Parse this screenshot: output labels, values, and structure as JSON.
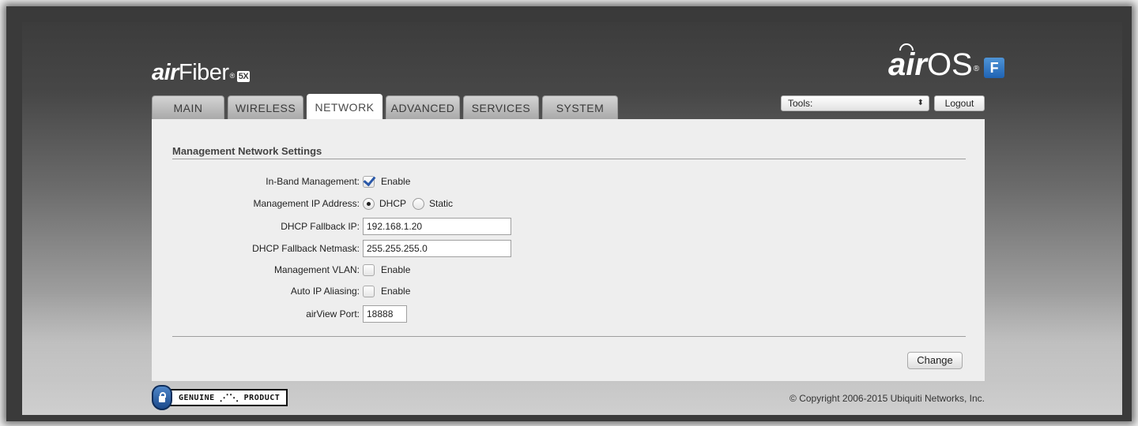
{
  "header": {
    "brand_ai": "air",
    "brand_name": "Fiber",
    "brand_reg": "®",
    "brand_badge": "5X",
    "os_ai": "air",
    "os_name": "OS",
    "os_reg": "®",
    "os_badge": "F"
  },
  "tabs": [
    {
      "label": "MAIN",
      "active": false
    },
    {
      "label": "WIRELESS",
      "active": false
    },
    {
      "label": "NETWORK",
      "active": true
    },
    {
      "label": "ADVANCED",
      "active": false
    },
    {
      "label": "SERVICES",
      "active": false
    },
    {
      "label": "SYSTEM",
      "active": false
    }
  ],
  "toolbar": {
    "tools_value": "Tools:",
    "tools_arrows": "⬍",
    "logout_label": "Logout"
  },
  "section": {
    "title": "Management Network Settings"
  },
  "form": {
    "inband": {
      "label": "In-Band Management:",
      "option": "Enable",
      "checked": true
    },
    "mgmt_ip": {
      "label": "Management IP Address:",
      "option_dhcp": "DHCP",
      "option_static": "Static",
      "selected": "DHCP"
    },
    "fallback_ip": {
      "label": "DHCP Fallback IP:",
      "value": "192.168.1.20"
    },
    "fallback_netmask": {
      "label": "DHCP Fallback Netmask:",
      "value": "255.255.255.0"
    },
    "mgmt_vlan": {
      "label": "Management VLAN:",
      "option": "Enable",
      "checked": false
    },
    "auto_ip": {
      "label": "Auto IP Aliasing:",
      "option": "Enable",
      "checked": false
    },
    "airview_port": {
      "label": "airView Port:",
      "value": "18888"
    }
  },
  "actions": {
    "change_label": "Change"
  },
  "footer": {
    "genuine_left": "GENUINE",
    "genuine_right": "PRODUCT",
    "copyright": "© Copyright 2006-2015 Ubiquiti Networks, Inc."
  },
  "colors": {
    "panel": "#eeeeee",
    "checkmark": "#2a58a8",
    "os_badge": "#2f78c8"
  }
}
